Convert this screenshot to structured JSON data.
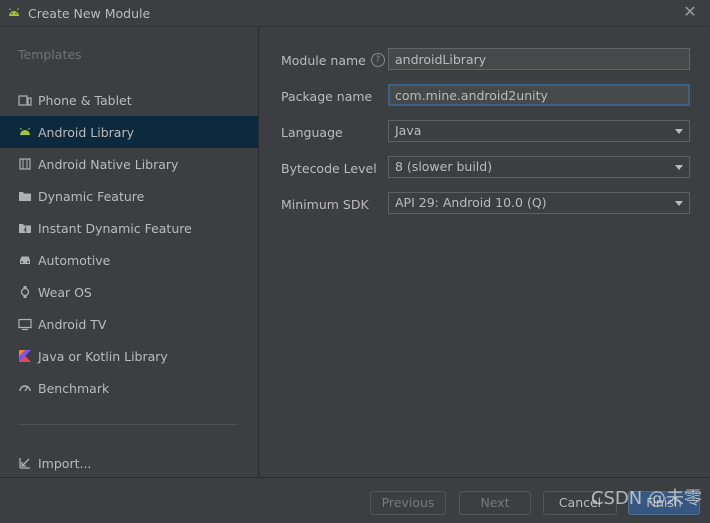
{
  "window": {
    "title": "Create New Module",
    "close_icon": "close-icon"
  },
  "sidebar": {
    "section_title": "Templates",
    "items": [
      {
        "label": "Phone & Tablet",
        "icon": "phone-tablet-icon",
        "selected": false
      },
      {
        "label": "Android Library",
        "icon": "android-icon",
        "selected": true
      },
      {
        "label": "Android Native Library",
        "icon": "native-library-icon",
        "selected": false
      },
      {
        "label": "Dynamic Feature",
        "icon": "folder-icon",
        "selected": false
      },
      {
        "label": "Instant Dynamic Feature",
        "icon": "instant-folder-icon",
        "selected": false
      },
      {
        "label": "Automotive",
        "icon": "car-icon",
        "selected": false
      },
      {
        "label": "Wear OS",
        "icon": "watch-icon",
        "selected": false
      },
      {
        "label": "Android TV",
        "icon": "tv-icon",
        "selected": false
      },
      {
        "label": "Java or Kotlin Library",
        "icon": "kotlin-icon",
        "selected": false
      },
      {
        "label": "Benchmark",
        "icon": "gauge-icon",
        "selected": false
      }
    ],
    "import_label": "Import..."
  },
  "form": {
    "module_name": {
      "label": "Module name",
      "value": "androidLibrary"
    },
    "package_name": {
      "label": "Package name",
      "value": "com.mine.android2unity"
    },
    "language": {
      "label": "Language",
      "value": "Java"
    },
    "bytecode_level": {
      "label": "Bytecode Level",
      "value": "8 (slower build)"
    },
    "minimum_sdk": {
      "label": "Minimum SDK",
      "value": "API 29: Android 10.0 (Q)"
    }
  },
  "footer": {
    "previous_label": "Previous",
    "next_label": "Next",
    "cancel_label": "Cancel",
    "finish_label": "Finish"
  },
  "watermark": "CSDN @未零",
  "colors": {
    "accent": "#365880",
    "selection": "#0d293e",
    "android_green": "#a4c639"
  }
}
